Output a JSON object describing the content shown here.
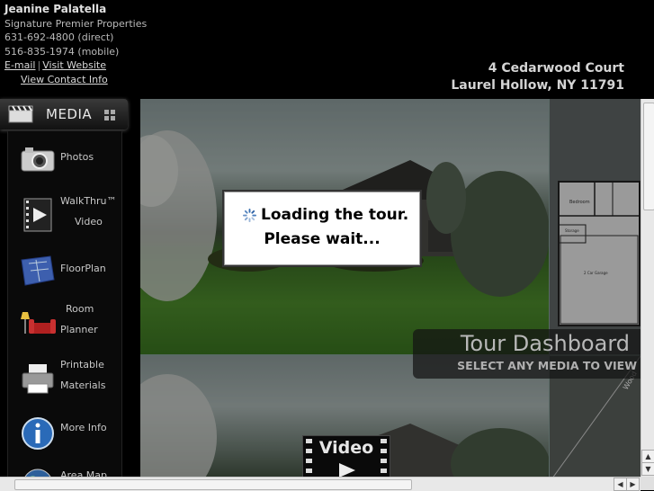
{
  "agent": {
    "name": "Jeanine Palatella",
    "company": "Signature Premier Properties",
    "phone_direct": "631-692-4800 (direct)",
    "phone_mobile": "516-835-1974 (mobile)",
    "email_link": "E-mail",
    "separator": "|",
    "website_link": "Visit Website",
    "contact_link": "View Contact Info"
  },
  "property": {
    "street": "4 Cedarwood Court",
    "city": "Laurel Hollow, NY 11791"
  },
  "media_panel": {
    "header": "MEDIA",
    "items": [
      {
        "line1": "Photos",
        "line2": "",
        "icon": "camera-icon"
      },
      {
        "line1": "WalkThru™",
        "line2": "Video",
        "icon": "film-play-icon"
      },
      {
        "line1": "FloorPlan",
        "line2": "",
        "icon": "blueprint-icon"
      },
      {
        "line1": "Room",
        "line2": "Planner",
        "icon": "furniture-icon"
      },
      {
        "line1": "Printable",
        "line2": "Materials",
        "icon": "printer-icon"
      },
      {
        "line1": "More Info",
        "line2": "",
        "icon": "info-icon"
      },
      {
        "line1": "Area Map",
        "line2": "",
        "icon": "globe-icon"
      }
    ]
  },
  "dashboard": {
    "title": "Tour Dashboard",
    "subtitle": "SELECT ANY MEDIA TO VIEW"
  },
  "video_button": "Video",
  "loading": {
    "line1": "Loading the tour.",
    "line2": "Please wait..."
  },
  "floorplan_labels": {
    "bedroom": "Bedroom",
    "storage": "Storage",
    "garage": "2 Car Garage",
    "wood": "Wood"
  },
  "colors": {
    "background": "#000000",
    "lawn": "#3a7420",
    "sky": "#a9b7b4"
  }
}
